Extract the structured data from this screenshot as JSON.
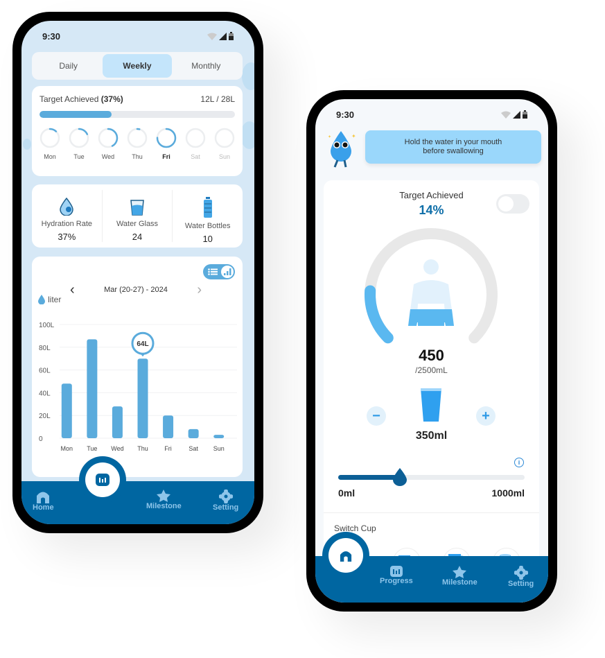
{
  "phone_left": {
    "status": {
      "time": "9:30"
    },
    "period_tabs": [
      {
        "label": "Daily",
        "active": false
      },
      {
        "label": "Weekly",
        "active": true
      },
      {
        "label": "Monthly",
        "active": false
      }
    ],
    "target": {
      "label": "Target Achieved",
      "percent_text": "(37%)",
      "amount": "12L / 28L",
      "progress": 0.37,
      "days": [
        {
          "label": "Mon",
          "progress": 0.12,
          "style": "normal"
        },
        {
          "label": "Tue",
          "progress": 0.18,
          "style": "normal"
        },
        {
          "label": "Wed",
          "progress": 0.42,
          "style": "normal"
        },
        {
          "label": "Thu",
          "progress": 0.04,
          "style": "normal"
        },
        {
          "label": "Fri",
          "progress": 0.75,
          "style": "bold"
        },
        {
          "label": "Sat",
          "progress": 0,
          "style": "dim"
        },
        {
          "label": "Sun",
          "progress": 0,
          "style": "dim"
        }
      ]
    },
    "stats": [
      {
        "icon": "water-drop-icon",
        "label": "Hydration Rate",
        "value": "37%"
      },
      {
        "icon": "water-glass-icon",
        "label": "Water Glass",
        "value": "24"
      },
      {
        "icon": "water-bottle-icon",
        "label": "Water Bottles",
        "value": "10"
      }
    ],
    "chart_header": {
      "date_range": "Mar (20-27) - 2024",
      "unit_label": "liter",
      "prev_icon": "chevron-left-icon",
      "next_icon": "chevron-right-icon"
    },
    "nav": [
      {
        "label": "Home",
        "icon": "home-icon"
      },
      {
        "label": "",
        "icon": "progress-icon",
        "active": true
      },
      {
        "label": "Milestone",
        "icon": "milestone-icon"
      },
      {
        "label": "Setting",
        "icon": "gear-icon"
      }
    ]
  },
  "chart_data": {
    "type": "bar",
    "title": "",
    "xlabel": "",
    "ylabel": "liter",
    "categories": [
      "Mon",
      "Tue",
      "Wed",
      "Thu",
      "Fri",
      "Sat",
      "Sun"
    ],
    "values": [
      48,
      87,
      28,
      70,
      20,
      8,
      3
    ],
    "ylim": [
      0,
      100
    ],
    "yticks": [
      0,
      20,
      40,
      60,
      80,
      100
    ],
    "ytick_labels": [
      "0",
      "20L",
      "40L",
      "60L",
      "80L",
      "100L"
    ],
    "grid": true,
    "annotation": {
      "category": "Thu",
      "text": "64L"
    },
    "color": "#5aabdc"
  },
  "phone_right": {
    "status": {
      "time": "9:30"
    },
    "tip": {
      "line1": "Hold the water in your mouth",
      "line2": "before swallowing"
    },
    "target": {
      "label": "Target Achieved",
      "percent": "14%",
      "fraction": 0.18
    },
    "intake": {
      "value": "450",
      "total": "/2500mL"
    },
    "cup": {
      "amount": "350ml",
      "minus": "−",
      "plus": "+"
    },
    "slider": {
      "min_label": "0ml",
      "max_label": "1000ml",
      "value": 350,
      "max": 1000
    },
    "switch_cup_label": "Switch Cup",
    "nav": [
      {
        "label": "",
        "icon": "home-icon",
        "active": true
      },
      {
        "label": "Progress",
        "icon": "progress-icon"
      },
      {
        "label": "Milestone",
        "icon": "milestone-icon"
      },
      {
        "label": "Setting",
        "icon": "gear-icon"
      }
    ],
    "colors": {
      "accent": "#0066a1",
      "light_blue": "#5ab8f0",
      "percent": "#0e6ea8"
    }
  }
}
